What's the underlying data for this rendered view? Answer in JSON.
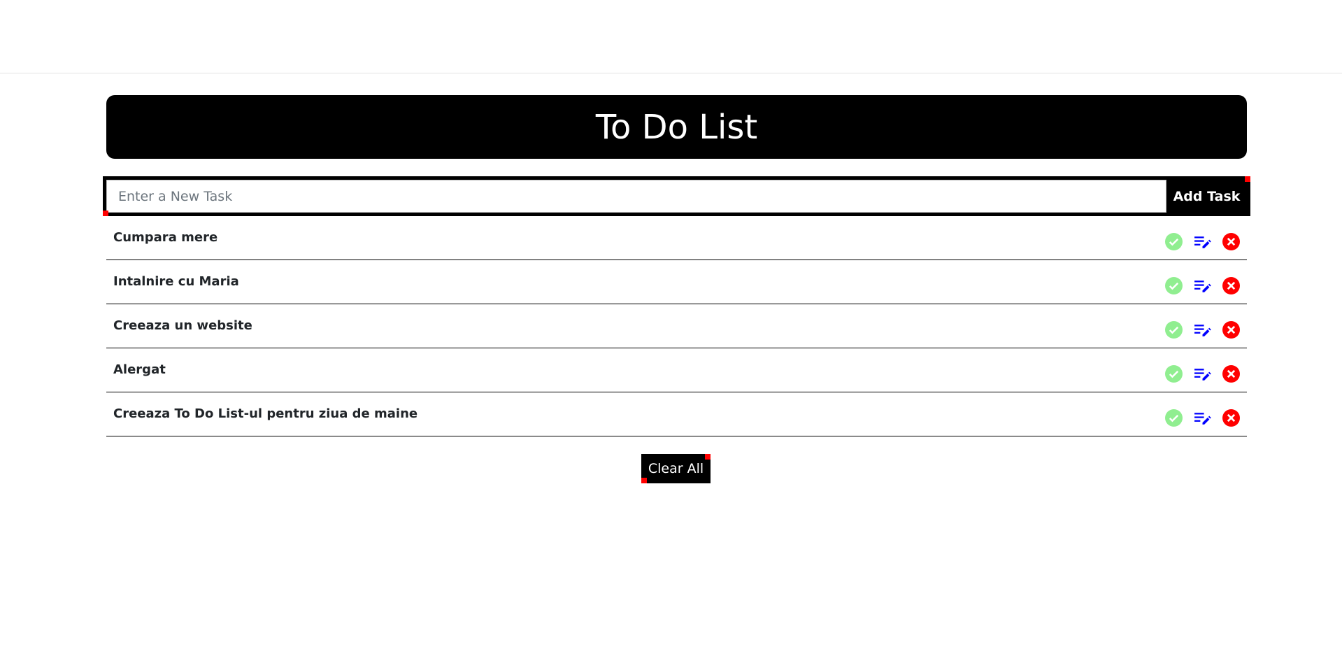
{
  "header": {
    "title": "To Do List"
  },
  "form": {
    "placeholder": "Enter a New Task",
    "value": "",
    "add_label": "Add Task"
  },
  "tasks": [
    {
      "text": "Cumpara mere"
    },
    {
      "text": "Intalnire cu Maria"
    },
    {
      "text": "Creeaza un website"
    },
    {
      "text": "Alergat"
    },
    {
      "text": "Creeaza To Do List-ul pentru ziua de maine"
    }
  ],
  "icons": {
    "complete": "check-circle-icon",
    "edit": "edit-list-icon",
    "delete": "x-circle-icon"
  },
  "colors": {
    "complete": "#90ee90",
    "edit": "#0000ff",
    "delete": "#ff0000",
    "accent": "#000000"
  },
  "clear_label": "Clear All"
}
